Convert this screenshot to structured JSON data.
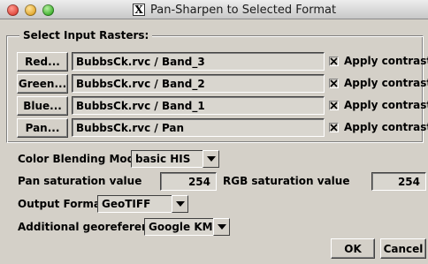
{
  "window": {
    "title": "Pan-Sharpen to Selected Format",
    "title_icon": "X"
  },
  "rasters": {
    "legend": "Select Input Rasters:",
    "rows": [
      {
        "button": "Red...",
        "value": "BubbsCk.rvc / Band_3",
        "check_label": "Apply contrast",
        "checked": true
      },
      {
        "button": "Green...",
        "value": "BubbsCk.rvc / Band_2",
        "check_label": "Apply contrast",
        "checked": true
      },
      {
        "button": "Blue...",
        "value": "BubbsCk.rvc / Band_1",
        "check_label": "Apply contrast",
        "checked": true
      },
      {
        "button": "Pan...",
        "value": "BubbsCk.rvc / Pan",
        "check_label": "Apply contrast",
        "checked": true
      }
    ]
  },
  "color_blending": {
    "label": "Color Blending Mode:",
    "value": "basic HIS"
  },
  "pan_saturation": {
    "label": "Pan saturation value",
    "value": "254"
  },
  "rgb_saturation": {
    "label": "RGB saturation value",
    "value": "254"
  },
  "output_format": {
    "label": "Output Format",
    "value": "GeoTIFF"
  },
  "georeference": {
    "label": "Additional georeference",
    "value": "Google KML"
  },
  "footer": {
    "ok_label": "OK",
    "cancel_label": "Cancel"
  },
  "icons": {
    "close": "close-traffic-light-icon",
    "minimize": "minimize-traffic-light-icon",
    "maximize": "maximize-traffic-light-icon",
    "dropdown": "dropdown-arrow-icon",
    "check": "checkmark-icon"
  }
}
